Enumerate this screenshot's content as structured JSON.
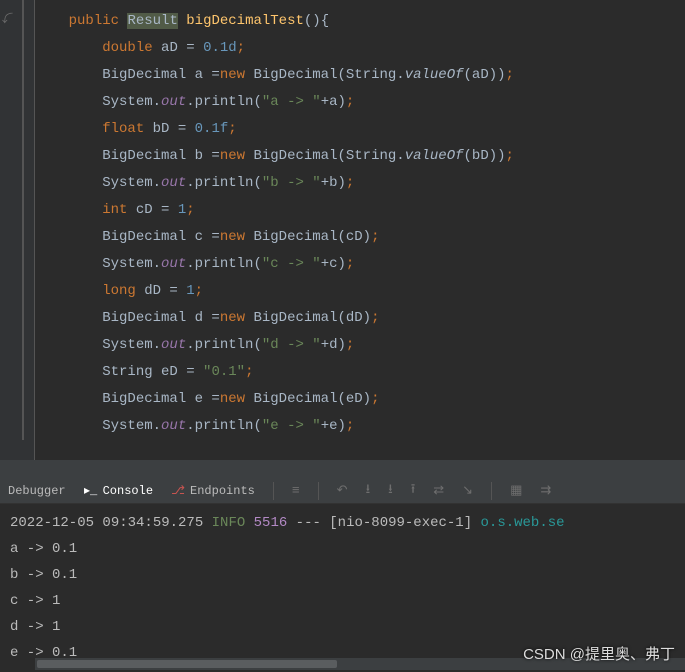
{
  "code": {
    "line1": {
      "indent": "    ",
      "public": "public",
      "result": "Result",
      "method": "bigDecimalTest",
      "paren": "()",
      "brace": "{"
    },
    "line2": {
      "indent": "        ",
      "type": "double",
      "var": " aD = ",
      "val": "0.1d",
      "semi": ";"
    },
    "line3": {
      "indent": "        ",
      "t1": "BigDecimal a =",
      "new": "new",
      "sp": " ",
      "t2": "BigDecimal(String.",
      "m": "valueOf",
      "t3": "(aD))",
      "semi": ";"
    },
    "line4": {
      "indent": "        ",
      "t1": "System.",
      "f": "out",
      "t2": ".println(",
      "s": "\"a -> \"",
      "t3": "+a)",
      "semi": ";"
    },
    "line5": {
      "indent": "        ",
      "type": "float",
      "var": " bD = ",
      "val": "0.1f",
      "semi": ";"
    },
    "line6": {
      "indent": "        ",
      "t1": "BigDecimal b =",
      "new": "new",
      "sp": " ",
      "t2": "BigDecimal(String.",
      "m": "valueOf",
      "t3": "(bD))",
      "semi": ";"
    },
    "line7": {
      "indent": "        ",
      "t1": "System.",
      "f": "out",
      "t2": ".println(",
      "s": "\"b -> \"",
      "t3": "+b)",
      "semi": ";"
    },
    "line8": {
      "indent": "        ",
      "type": "int",
      "var": " cD = ",
      "val": "1",
      "semi": ";"
    },
    "line9": {
      "indent": "        ",
      "t1": "BigDecimal c =",
      "new": "new",
      "sp": " ",
      "t2": "BigDecimal(cD)",
      "semi": ";"
    },
    "line10": {
      "indent": "        ",
      "t1": "System.",
      "f": "out",
      "t2": ".println(",
      "s": "\"c -> \"",
      "t3": "+c)",
      "semi": ";"
    },
    "line11": {
      "indent": "        ",
      "type": "long",
      "var": " dD = ",
      "val": "1",
      "semi": ";"
    },
    "line12": {
      "indent": "        ",
      "t1": "BigDecimal d =",
      "new": "new",
      "sp": " ",
      "t2": "BigDecimal(dD)",
      "semi": ";"
    },
    "line13": {
      "indent": "        ",
      "t1": "System.",
      "f": "out",
      "t2": ".println(",
      "s": "\"d -> \"",
      "t3": "+d)",
      "semi": ";"
    },
    "line14": {
      "indent": "        ",
      "t1": "String eD = ",
      "s": "\"0.1\"",
      "semi": ";"
    },
    "line15": {
      "indent": "        ",
      "t1": "BigDecimal e =",
      "new": "new",
      "sp": " ",
      "t2": "BigDecimal(eD)",
      "semi": ";"
    },
    "line16": {
      "indent": "        ",
      "t1": "System.",
      "f": "out",
      "t2": ".println(",
      "s": "\"e -> \"",
      "t3": "+e)",
      "semi": ";"
    }
  },
  "tabs": {
    "debugger": "Debugger",
    "console": "Console",
    "endpoints": "Endpoints"
  },
  "console": {
    "logline": {
      "time": "2022-12-05 09:34:59.275",
      "level": "INFO",
      "pid": "5516",
      "dash": " --- ",
      "thread": "[nio-8099-exec-1]",
      "source": "o.s.web.se"
    },
    "out": [
      "a -> 0.1",
      "b -> 0.1",
      "c -> 1",
      "d -> 1",
      "e -> 0.1"
    ]
  },
  "watermark": "CSDN @提里奥、弗丁"
}
